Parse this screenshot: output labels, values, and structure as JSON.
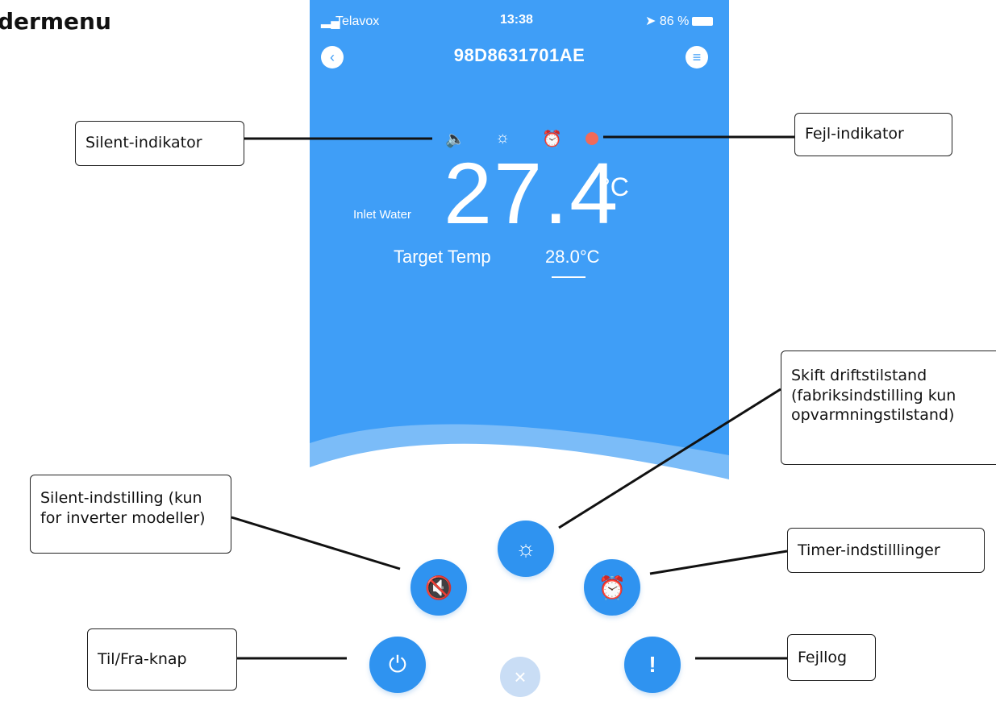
{
  "heading": "dermenu",
  "status_bar": {
    "carrier": "Telavox",
    "time": "13:38",
    "battery": "86 %"
  },
  "device_title": "98D8631701AE",
  "nav": {
    "back_icon": "chevron-left-icon",
    "menu_icon": "menu-icon"
  },
  "indicators": [
    "speaker-icon",
    "sun-icon",
    "alarm-clock-icon",
    "error-dot-icon"
  ],
  "inlet_label": "Inlet Water",
  "temperature": {
    "value": "27.4",
    "unit": "°C"
  },
  "target": {
    "label": "Target Temp",
    "value": "28.0°C"
  },
  "controls": {
    "mode_icon": "sun-icon",
    "silent_icon": "mute-icon",
    "timer_icon": "alarm-clock-icon",
    "power_icon": "power-icon",
    "fault_icon": "exclamation-icon",
    "close_icon": "close-icon"
  },
  "callouts": {
    "silent_indicator": "Silent-indikator",
    "fault_indicator": "Fejl-indikator",
    "mode_line1": "Skift driftstilstand",
    "mode_line2": "(fabriksindstilling kun",
    "mode_line3": "opvarmningstilstand)",
    "silent_setting_line1": "Silent-indstilling (kun",
    "silent_setting_line2": "for inverter modeller)",
    "timer": "Timer-indstilllinger",
    "power": "Til/Fra-knap",
    "fault_log": "Fejllog"
  },
  "colors": {
    "app_blue": "#3f9ef7",
    "button_blue": "#2f93f0",
    "error_red": "#f06a5a"
  }
}
